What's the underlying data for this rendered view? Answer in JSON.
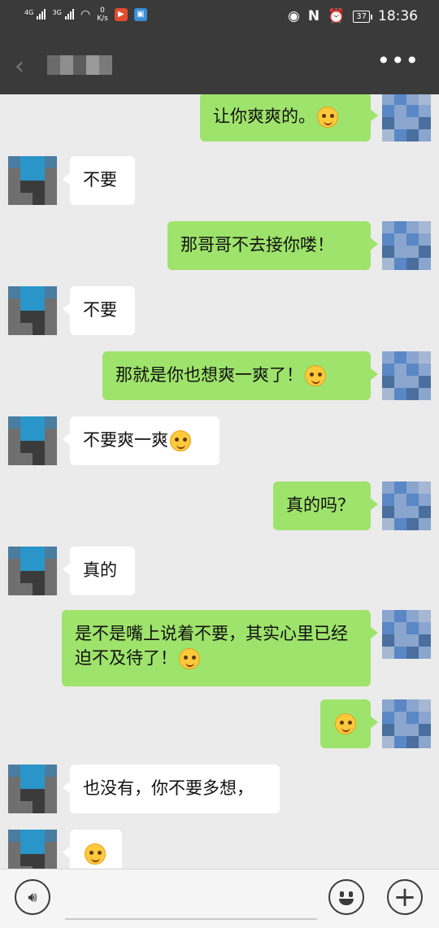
{
  "status_bar": {
    "net1": "4G",
    "net2": "3G",
    "speed_value": "0",
    "speed_unit": "K/s",
    "battery": "37",
    "time": "18:36"
  },
  "header": {
    "back_icon": "chevron-left-icon",
    "more_label": "•••"
  },
  "messages": [
    {
      "side": "right",
      "text": "让你爽爽的。",
      "emoji": "blush-emoji"
    },
    {
      "side": "left",
      "text": "不要"
    },
    {
      "side": "right",
      "text": "那哥哥不去接你喽！"
    },
    {
      "side": "left",
      "text": "不要"
    },
    {
      "side": "right",
      "text": "那就是你也想爽一爽了！",
      "emoji": "wink-tongue-emoji"
    },
    {
      "side": "left",
      "text": "不要爽一爽",
      "emoji": "laugh-cry-emoji"
    },
    {
      "side": "right",
      "text": "真的吗？"
    },
    {
      "side": "left",
      "text": "真的"
    },
    {
      "side": "right",
      "text": "是不是嘴上说着不要，其实心里已经迫不及待了！",
      "emoji": "blush-emoji"
    },
    {
      "side": "right",
      "text": "",
      "emoji": "grin-emoji"
    },
    {
      "side": "left",
      "text": "也没有，你不要多想，"
    },
    {
      "side": "left",
      "text": "",
      "emoji": "laugh-cry-emoji"
    }
  ],
  "input_bar": {
    "voice_icon": "voice-icon",
    "emoji_icon": "emoji-face-icon",
    "plus_label": "+"
  },
  "colors": {
    "header_bg": "#3a3a3a",
    "chat_bg": "#ebebeb",
    "bubble_self": "#9ee36b",
    "bubble_other": "#ffffff"
  }
}
